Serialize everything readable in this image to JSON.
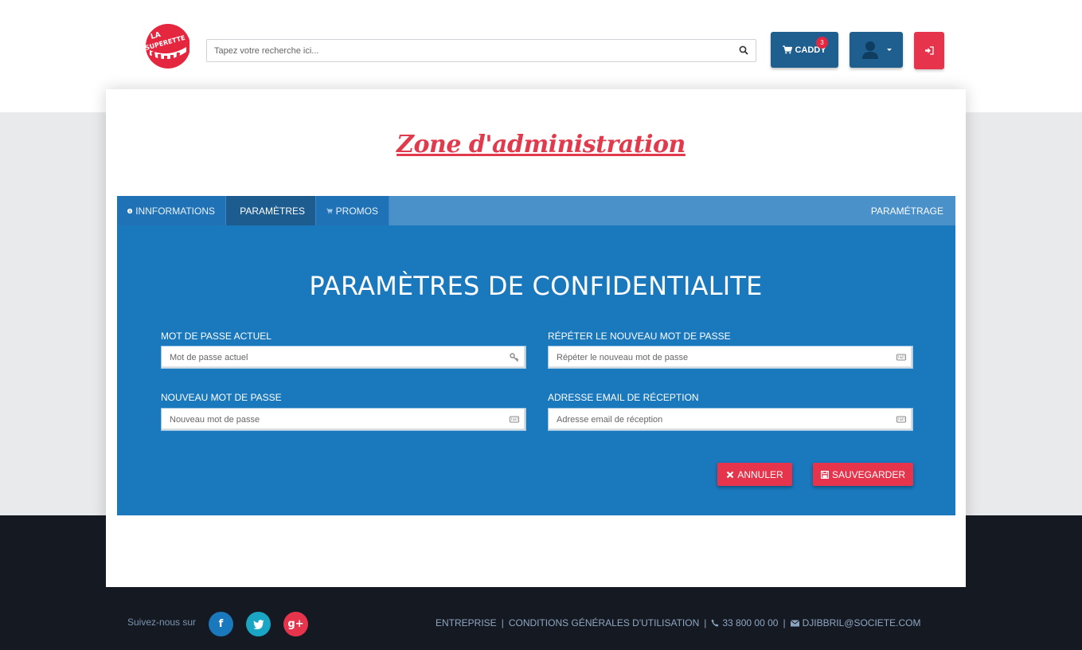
{
  "header": {
    "logo_text_top": "LA",
    "logo_text_bottom": "SUPERETTE",
    "search_placeholder": "Tapez votre recherche ici...",
    "caddy_label": "CADDY",
    "caddy_count": "3"
  },
  "page": {
    "title": "Zone d'administration"
  },
  "tabs": [
    {
      "label": "INNFORMATIONS",
      "icon": "info-icon"
    },
    {
      "label": "PARAMÈTRES",
      "icon": "user-icon"
    },
    {
      "label": "PROMOS",
      "icon": "cart-icon"
    }
  ],
  "tab_right_label": "PARAMÉTRAGE",
  "form": {
    "title": "PARAMÈTRES DE CONFIDENTIALITE",
    "current_password": {
      "label": "MOT DE PASSE ACTUEL",
      "placeholder": "Mot de passe actuel"
    },
    "repeat_password": {
      "label": "RÉPÉTER LE NOUVEAU MOT DE PASSE",
      "placeholder": "Répéter le nouveau mot de passe"
    },
    "new_password": {
      "label": "NOUVEAU MOT DE PASSE",
      "placeholder": "Nouveau mot de passe"
    },
    "email": {
      "label": "ADRESSE EMAIL DE RÉCEPTION",
      "placeholder": "Adresse email de réception"
    },
    "cancel_label": "ANNULER",
    "save_label": "SAUVEGARDER"
  },
  "footer": {
    "follow_label": "Suivez-nous sur",
    "links": {
      "company": "ENTREPRISE",
      "terms": "CONDITIONS GÉNÉRALES D'UTILISATION",
      "phone": "33 800 00 00",
      "email": "DJIBBRIL@SOCIETE.COM",
      "separator": "|"
    },
    "social": {
      "facebook": "f",
      "twitter": "t",
      "google": "g+"
    }
  },
  "colors": {
    "primary_blue": "#1a78bd",
    "dark_blue": "#1f5f8f",
    "accent_red": "#e5344b",
    "footer_bg": "#151a22"
  }
}
